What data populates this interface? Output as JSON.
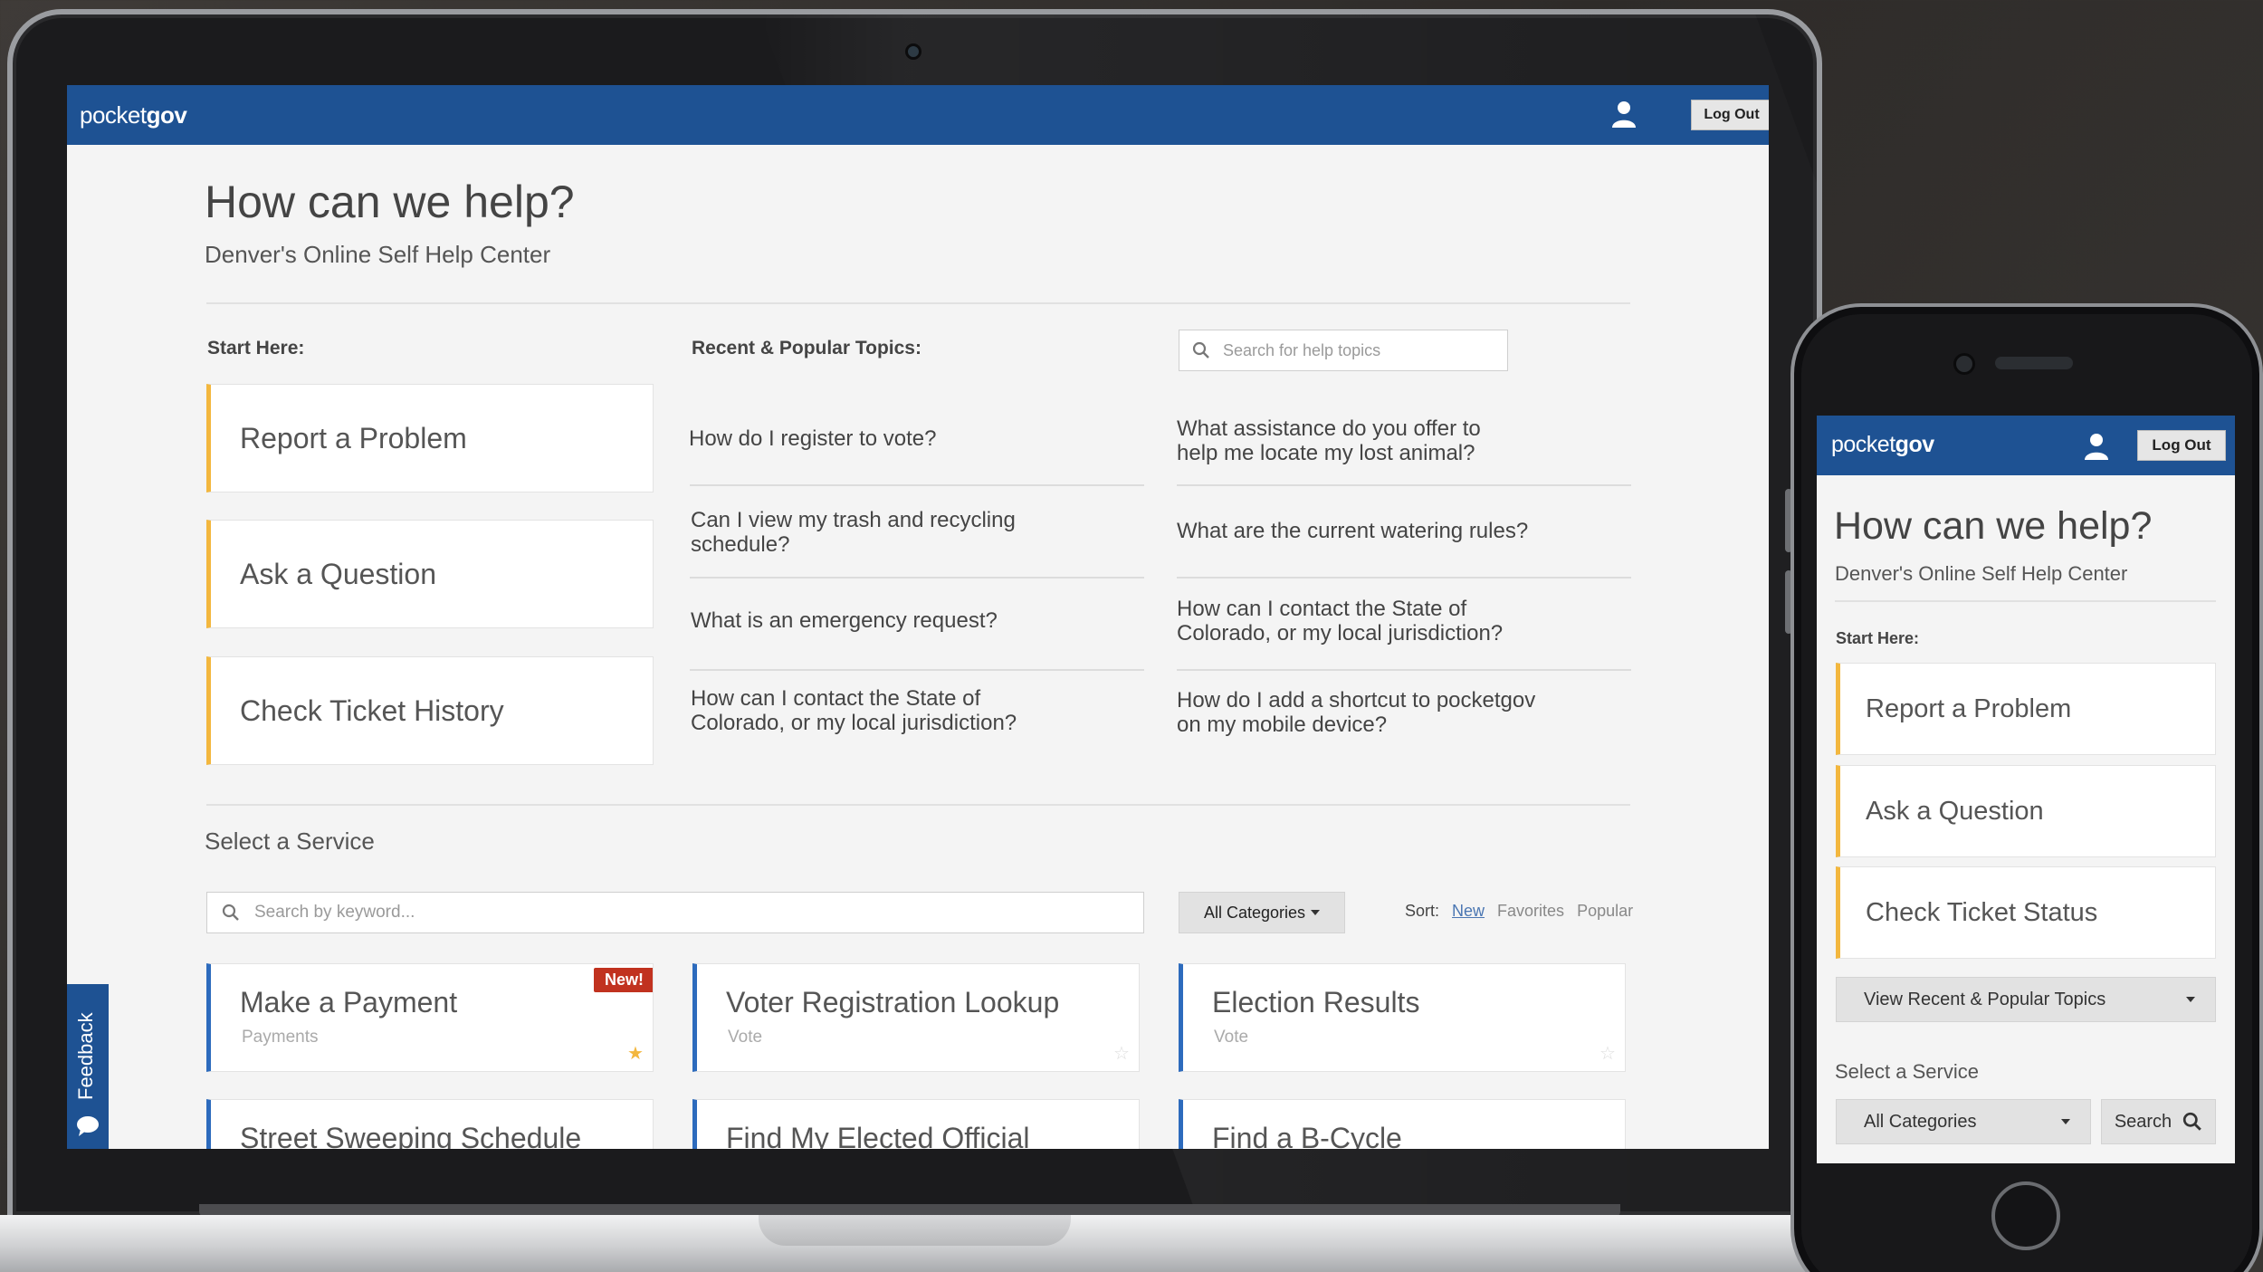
{
  "desktop": {
    "header": {
      "logo_light": "pocket",
      "logo_bold": "gov",
      "logout_label": "Log Out"
    },
    "title": "How can we help?",
    "subtitle": "Denver's Online Self Help Center",
    "start_here_label": "Start Here:",
    "start_items": [
      "Report a Problem",
      "Ask a Question",
      "Check Ticket History"
    ],
    "topics_label": "Recent & Popular Topics:",
    "topic_search_placeholder": "Search for help topics",
    "topics_left": [
      {
        "line1": "How do I register to vote?",
        "line2": ""
      },
      {
        "line1": "Can I view my trash and recycling",
        "line2": "schedule?"
      },
      {
        "line1": "What is an emergency request?",
        "line2": ""
      },
      {
        "line1": "How can I contact the State of",
        "line2": "Colorado, or my local jurisdiction?"
      }
    ],
    "topics_right": [
      {
        "line1": "What assistance do you offer to",
        "line2": "help me locate my lost animal?"
      },
      {
        "line1": "What are the current watering rules?",
        "line2": ""
      },
      {
        "line1": "How can I contact the State of",
        "line2": "Colorado, or my local jurisdiction?"
      },
      {
        "line1": "How do I add a shortcut to pocketgov",
        "line2": "on my mobile device?"
      }
    ],
    "select_service_title": "Select a Service",
    "keyword_search_placeholder": "Search by keyword...",
    "categories_label": "All Categories",
    "sort": {
      "label": "Sort:",
      "options": [
        "New",
        "Favorites",
        "Popular"
      ],
      "active": "New"
    },
    "services": [
      {
        "name": "Make a Payment",
        "category": "Payments",
        "badge": "New!",
        "favorite": true
      },
      {
        "name": "Voter Registration Lookup",
        "category": "Vote",
        "badge": "",
        "favorite": false
      },
      {
        "name": "Election Results",
        "category": "Vote",
        "badge": "",
        "favorite": false
      },
      {
        "name": "Street Sweeping Schedule",
        "category": "",
        "badge": "",
        "favorite": false
      },
      {
        "name": "Find My Elected Official",
        "category": "",
        "badge": "",
        "favorite": false
      },
      {
        "name": "Find a B-Cycle",
        "category": "",
        "badge": "",
        "favorite": false
      }
    ],
    "feedback_label": "Feedback"
  },
  "mobile": {
    "header": {
      "logo_light": "pocket",
      "logo_bold": "gov",
      "logout_label": "Log Out"
    },
    "title": "How can we help?",
    "subtitle": "Denver's Online Self Help Center",
    "start_here_label": "Start Here:",
    "start_items": [
      "Report a Problem",
      "Ask a Question",
      "Check Ticket Status"
    ],
    "topics_dropdown_label": "View Recent & Popular Topics",
    "select_service_title": "Select a Service",
    "categories_label": "All Categories",
    "search_button_label": "Search"
  },
  "colors": {
    "brand_blue": "#1e5293",
    "start_accent": "#f3b73e",
    "service_accent": "#2d6bbd",
    "badge_red": "#c1321f",
    "favorite_star": "#f3b73e"
  }
}
